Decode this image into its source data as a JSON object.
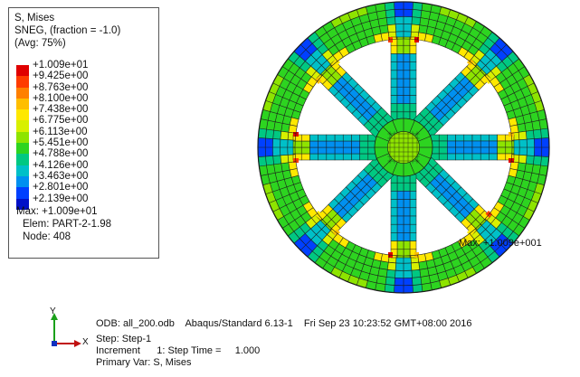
{
  "legend": {
    "title": "S, Mises",
    "subtitle": "SNEG, (fraction = -1.0)",
    "avg": "(Avg: 75%)",
    "ticks": [
      "+1.009e+01",
      "+9.425e+00",
      "+8.763e+00",
      "+8.100e+00",
      "+7.438e+00",
      "+6.775e+00",
      "+6.113e+00",
      "+5.451e+00",
      "+4.788e+00",
      "+4.126e+00",
      "+3.463e+00",
      "+2.801e+00",
      "+2.139e+00"
    ],
    "colors": [
      "#e00000",
      "#ff3c00",
      "#ff8000",
      "#ffbe00",
      "#ffe800",
      "#d8f000",
      "#8ee400",
      "#2dd420",
      "#00c882",
      "#00c0c8",
      "#0090f0",
      "#0040ff",
      "#0010c8"
    ],
    "max_label": "Max: +1.009e+01",
    "elem_label": "Elem: PART-2-1.98",
    "node_label": "Node: 408"
  },
  "contour": {
    "max_annotation": "Max: +1.009e+001"
  },
  "triad": {
    "y_label": "Y",
    "x_label": "X"
  },
  "info": {
    "odb_line": "ODB: all_200.odb    Abaqus/Standard 6.13-1    Fri Sep 23 10:23:52 GMT+08:00 2016",
    "step_line": "Step: Step-1",
    "increment_line": "Increment      1: Step Time =     1.000",
    "primary_line": "Primary Var: S, Mises"
  }
}
